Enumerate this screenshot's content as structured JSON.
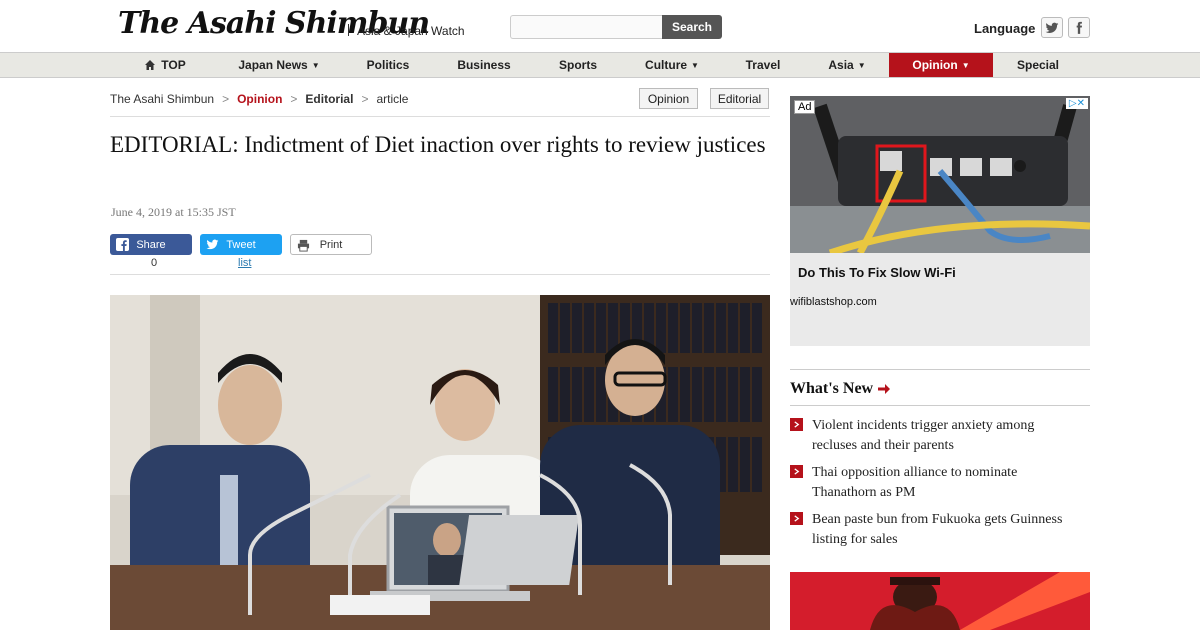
{
  "header": {
    "logo": "The Asahi Shimbun",
    "tagline": "Asia & Japan Watch",
    "search_placeholder": "",
    "search_label": "Search",
    "language_label": "Language",
    "twitter_icon": "twitter-icon",
    "facebook_icon": "facebook-icon"
  },
  "nav": {
    "items": [
      {
        "label": "TOP",
        "icon": "home-icon"
      },
      {
        "label": "Japan News",
        "dropdown": true
      },
      {
        "label": "Politics"
      },
      {
        "label": "Business"
      },
      {
        "label": "Sports"
      },
      {
        "label": "Culture",
        "dropdown": true
      },
      {
        "label": "Travel"
      },
      {
        "label": "Asia",
        "dropdown": true
      },
      {
        "label": "Opinion",
        "dropdown": true,
        "active": true
      },
      {
        "label": "Special"
      }
    ],
    "caret": "▼"
  },
  "breadcrumb": {
    "items": [
      "The Asahi Shimbun",
      "Opinion",
      "Editorial",
      "article"
    ],
    "separator": ">"
  },
  "tags": [
    "Opinion",
    "Editorial"
  ],
  "article": {
    "headline": "EDITORIAL: Indictment of Diet inaction over rights to review justices",
    "dateline": "June 4, 2019 at 15:35 JST"
  },
  "share": {
    "facebook_label": "Share",
    "facebook_count": "0",
    "twitter_label": "Tweet",
    "twitter_count": "list",
    "print_label": "Print"
  },
  "sidebar": {
    "ad": {
      "label": "Ad",
      "choices": "▷✕",
      "title": "Do This To Fix Slow Wi-Fi",
      "domain": "wifiblastshop.com"
    },
    "whats_new": {
      "title": "What's New",
      "items": [
        "Violent incidents trigger anxiety among recluses and their parents",
        "Thai opposition alliance to nominate Thanathorn as PM",
        "Bean paste bun from Fukuoka gets Guinness listing for sales"
      ]
    }
  },
  "colors": {
    "brand_red": "#b5121b",
    "facebook": "#3b5998",
    "twitter": "#1da1f2",
    "nav_bg": "#e8e8e3"
  }
}
